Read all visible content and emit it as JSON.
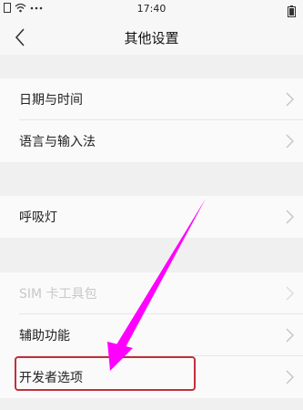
{
  "status_bar": {
    "time": "17:40",
    "icons": [
      "sim-icon",
      "wifi-icon",
      "more-icon",
      "battery-icon"
    ]
  },
  "header": {
    "title": "其他设置",
    "back_icon": "back-chevron-icon"
  },
  "groups": [
    {
      "items": [
        {
          "label": "日期与时间"
        },
        {
          "label": "语言与输入法"
        }
      ]
    },
    {
      "items": [
        {
          "label": "呼吸灯"
        }
      ]
    },
    {
      "items": [
        {
          "label": "SIM 卡工具包",
          "disabled": true
        },
        {
          "label": "辅助功能"
        },
        {
          "label": "开发者选项",
          "highlighted": true
        }
      ]
    }
  ],
  "annotation": {
    "arrow_color": "#ff00ff",
    "highlight_color": "#c0303a"
  }
}
